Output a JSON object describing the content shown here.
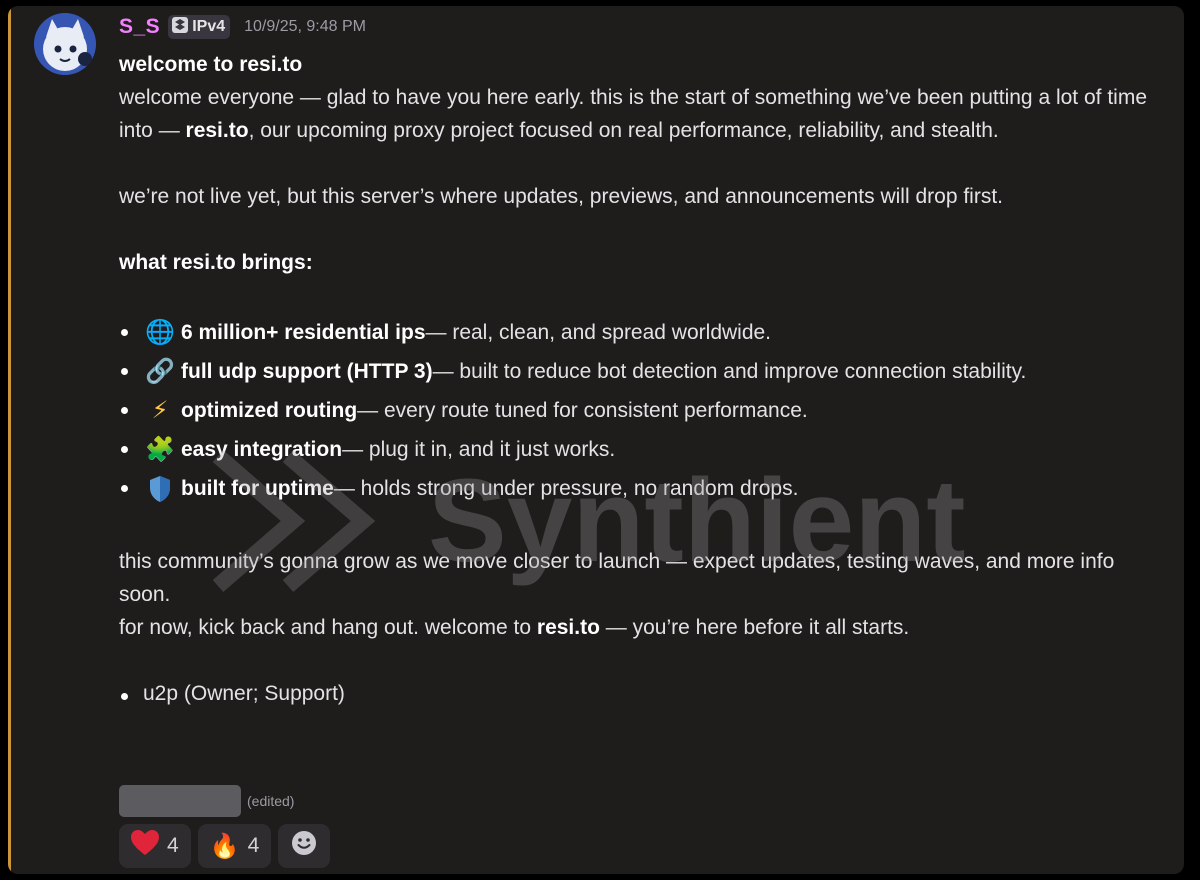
{
  "header": {
    "username": "S_S",
    "tag": "IPv4",
    "timestamp": "10/9/25, 9:48 PM"
  },
  "message": {
    "title": "welcome to resi.to",
    "intro": {
      "part1": "welcome everyone — glad to have you here early. this is the start of something we’ve been putting a lot of time into — ",
      "bold": "resi.to",
      "part2": ", our upcoming proxy project focused on real performance, reliability, and stealth."
    },
    "paragraph2": "we’re not live yet, but this server’s where updates, previews, and announcements will drop first.",
    "features_heading": "what resi.to brings:",
    "features": [
      {
        "icon": "globe-icon",
        "glyph": "🌐",
        "title": "6 million+ residential ips",
        "desc": " — real, clean, and spread worldwide."
      },
      {
        "icon": "link-icon",
        "glyph": "🔗",
        "title": "full udp support (HTTP 3)",
        "desc": " — built to reduce bot detection and improve connection stability."
      },
      {
        "icon": "lightning-icon",
        "glyph": "⚡",
        "title": "optimized routing",
        "desc": " — every route tuned for consistent performance."
      },
      {
        "icon": "puzzle-icon",
        "glyph": "🧩",
        "title": "easy integration",
        "desc": " — plug it in, and it just works."
      },
      {
        "icon": "shield-icon",
        "glyph": "🛡",
        "title": "built for uptime",
        "desc": " — holds strong under pressure, no random drops."
      }
    ],
    "closing1": "this community’s gonna grow as we move closer to launch — expect updates, testing waves, and more info soon.",
    "closing2": {
      "part1": "for now, kick back and hang out. welcome to ",
      "bold": "resi.to",
      "part2": " — you’re here before it all starts."
    },
    "signature": "u2p (Owner; Support)",
    "edited": "(edited)"
  },
  "reactions": [
    {
      "icon": "heart-icon",
      "glyph": "❤",
      "count": "4"
    },
    {
      "icon": "fire-icon",
      "glyph": "🔥",
      "count": "4"
    },
    {
      "icon": "add-reaction-icon",
      "glyph": "",
      "count": ""
    }
  ],
  "watermark": "Synthient",
  "colors": {
    "username": "#f47fff",
    "accent_bar": "#c9963a",
    "background": "#1f1c1c"
  }
}
